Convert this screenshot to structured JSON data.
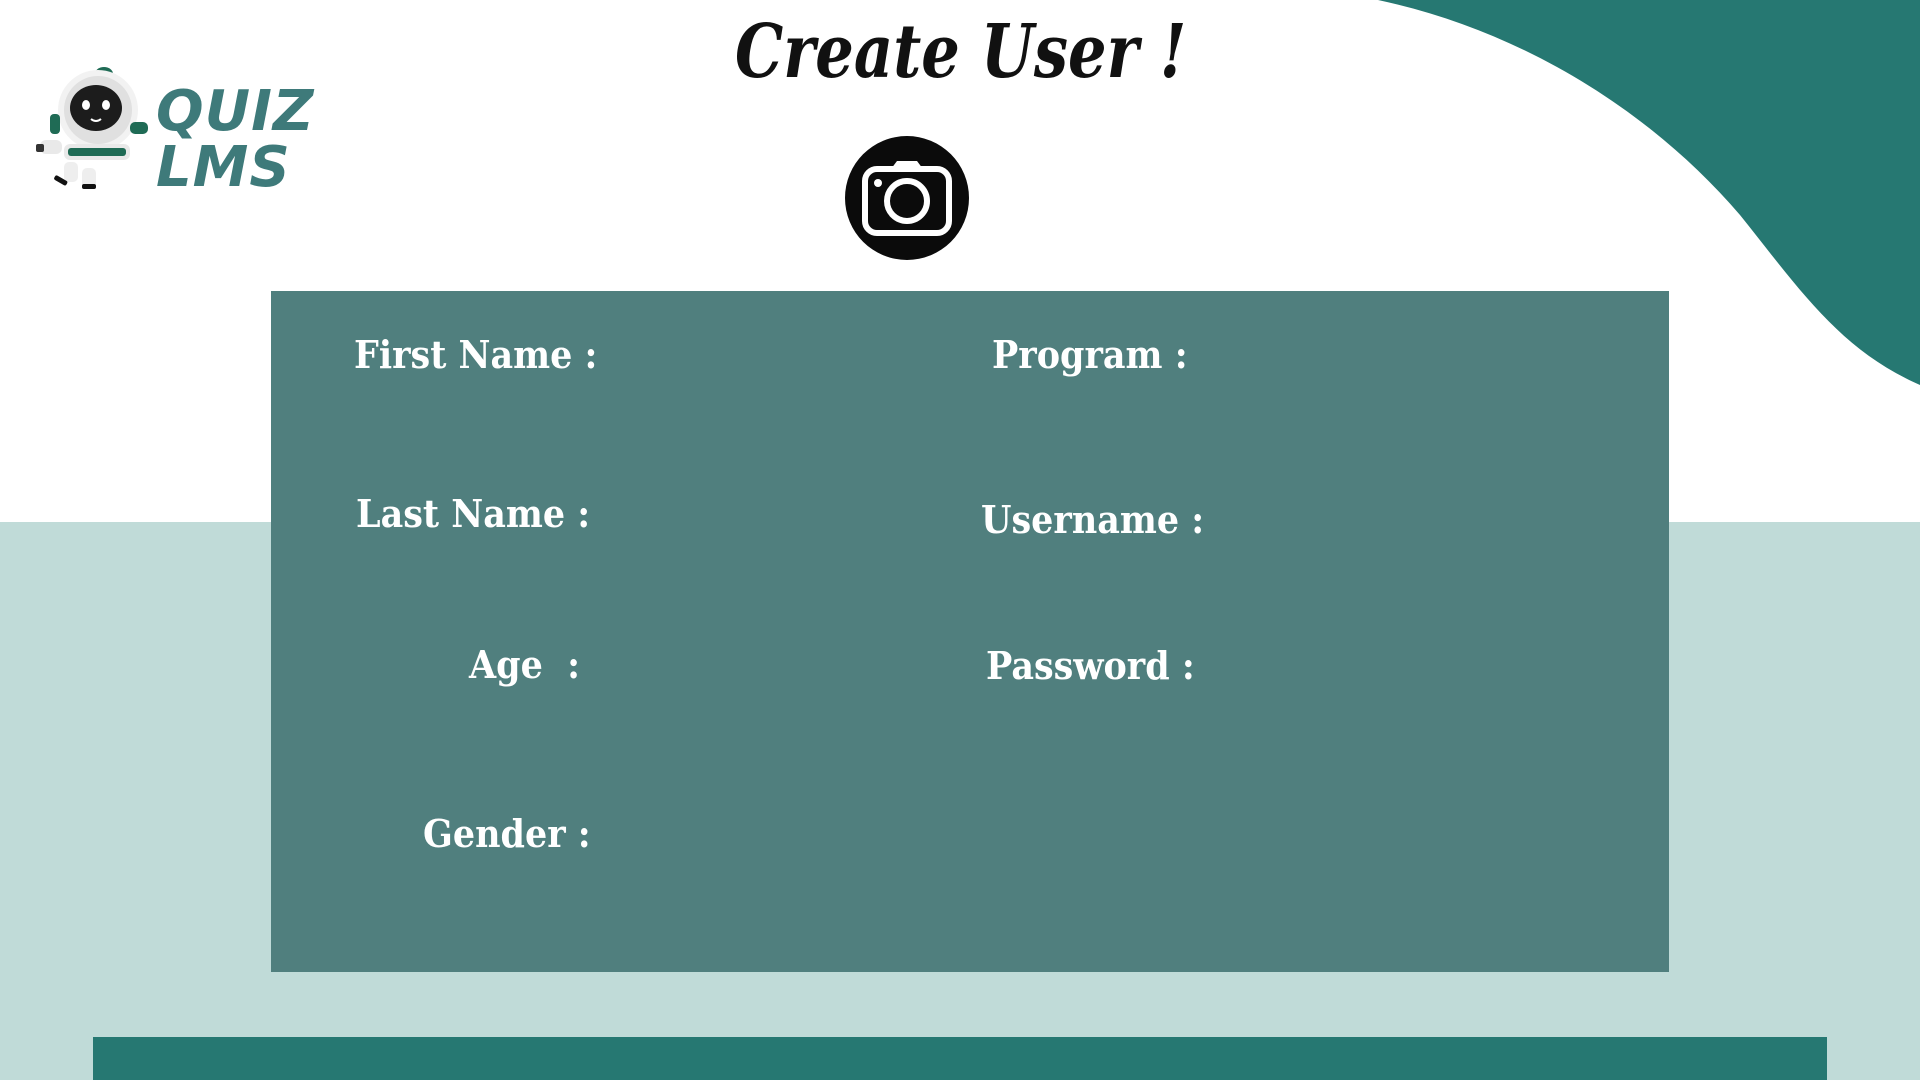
{
  "app": {
    "logo_text": "QUIZ LMS",
    "page_title": "Create User !"
  },
  "form": {
    "fields": {
      "first_name": "First Name :",
      "last_name": "Last Name :",
      "age": "Age  :",
      "gender": "Gender :",
      "program": "Program :",
      "username": "Username :",
      "password": "Password :"
    }
  },
  "icons": {
    "camera": "camera-icon",
    "mascot": "robot-mascot-icon"
  },
  "colors": {
    "primary_teal": "#267872",
    "panel_teal": "#507f7e",
    "light_teal_bg": "#c0dbd8",
    "logo_text": "#3e7a7a",
    "white": "#ffffff",
    "black": "#0b0b0b"
  }
}
